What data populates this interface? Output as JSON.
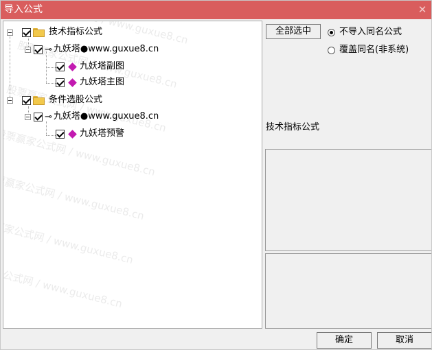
{
  "window": {
    "title": "导入公式",
    "close_glyph": "✕"
  },
  "tree": {
    "groups": [
      {
        "label": "技术指标公式",
        "item": {
          "label": "九妖塔●www.guxue8.cn",
          "children": [
            "九妖塔副图",
            "九妖塔主图"
          ]
        }
      },
      {
        "label": "条件选股公式",
        "item": {
          "label": "九妖塔●www.guxue8.cn",
          "children": [
            "九妖塔预警"
          ]
        }
      }
    ],
    "watermark": {
      "cn": "股票赢家公式网",
      "sep": "/",
      "url": "www.guxue8.cn"
    }
  },
  "options": {
    "select_all_label": "全部选中",
    "radio_no_import": "不导入同名公式",
    "radio_overwrite": "覆盖同名(非系统)",
    "selected": "no_import"
  },
  "info": {
    "label": "技术指标公式"
  },
  "buttons": {
    "ok": "确定",
    "cancel": "取消"
  },
  "icons": {
    "folder": "folder-icon",
    "key": "key-icon",
    "formula": "diamond-icon",
    "expander": "minus-box-icon",
    "close": "close-icon"
  },
  "colors": {
    "titlebar": "#d95d5d",
    "formula_icon": "#c21ab0",
    "folder": "#f2c94c"
  }
}
